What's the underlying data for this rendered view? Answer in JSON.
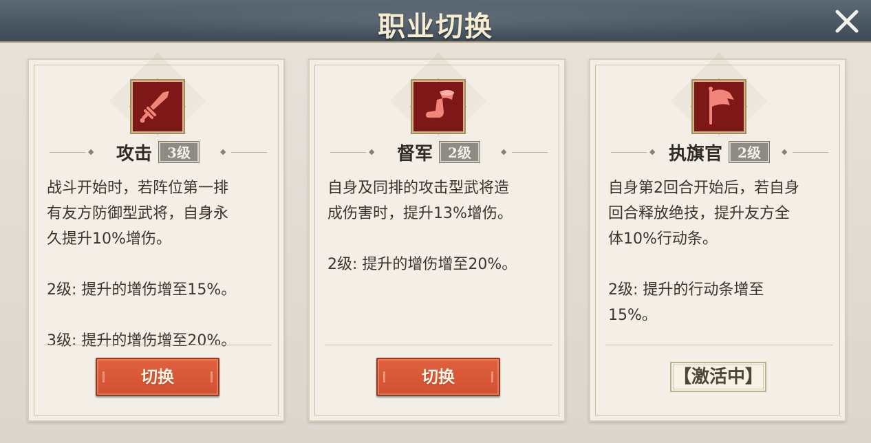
{
  "header": {
    "title": "职业切换"
  },
  "cards": [
    {
      "name": "攻击",
      "level": "3级",
      "icon": "sword-icon",
      "desc_lines": [
        "战斗开始时，若阵位第一排",
        "有友方防御型武将，自身永",
        "久提升10%增伤。"
      ],
      "level_lines": [
        "2级: 提升的增伤增至15%。",
        "3级: 提升的增伤增至20%。"
      ],
      "action_label": "切换",
      "state": "switch"
    },
    {
      "name": "督军",
      "level": "2级",
      "icon": "horn-icon",
      "desc_lines": [
        "自身及同排的攻击型武将造",
        "成伤害时，提升13%增伤。"
      ],
      "level_lines": [
        "2级: 提升的增伤增至20%。"
      ],
      "action_label": "切换",
      "state": "switch"
    },
    {
      "name": "执旗官",
      "level": "2级",
      "icon": "flag-icon",
      "desc_lines": [
        "自身第2回合开始后，若自身",
        "回合释放绝技，提升友方全",
        "体10%行动条。"
      ],
      "level_lines": [
        "2级: 提升的行动条增至",
        "15%。"
      ],
      "action_label": "【激活中】",
      "state": "active"
    }
  ],
  "colors": {
    "button": "#d9573a",
    "emblem": "#8e1c1c",
    "emblem_border": "#a88b5c"
  }
}
